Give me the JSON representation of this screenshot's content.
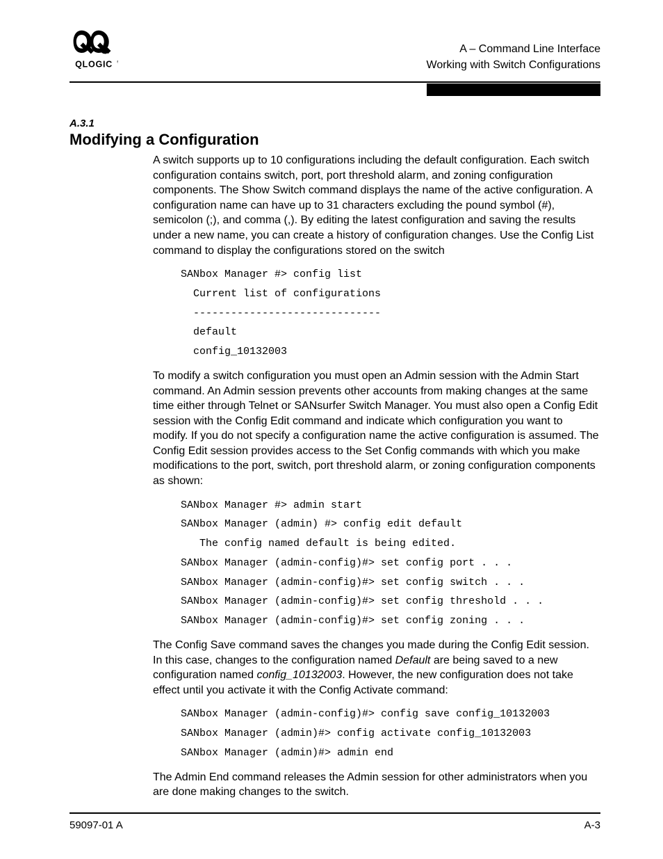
{
  "header": {
    "line1": "A – Command Line Interface",
    "line2": "Working with Switch Configurations"
  },
  "section": {
    "number": "A.3.1",
    "title": "Modifying a Configuration"
  },
  "para1": " A switch supports up to 10 configurations including the default configuration. Each switch configuration contains switch, port, port threshold alarm, and zoning configuration components. The Show Switch command displays the name of the active configuration. A configuration name can have up to 31 characters excluding the pound symbol (#), semicolon (;), and comma (,). By editing the latest configuration and saving the results under a new name, you can create a history of configuration changes. Use the Config List command to display the configurations stored on the switch",
  "code1": "SANbox Manager #> config list\n  Current list of configurations\n  ------------------------------\n  default\n  config_10132003",
  "para2": "To modify a switch configuration you must open an Admin session with the Admin Start command. An Admin session prevents other accounts from making changes at the same time either through Telnet or SANsurfer Switch Manager. You must also open a Config Edit session with the Config Edit command and indicate which configuration you want to modify. If you do not specify a configuration name the active configuration is assumed. The Config Edit session provides access to the Set Config commands with which you make modifications to the port, switch, port threshold alarm, or zoning configuration components as shown:",
  "code2": "SANbox Manager #> admin start\nSANbox Manager (admin) #> config edit default\n   The config named default is being edited.\nSANbox Manager (admin-config)#> set config port . . .\nSANbox Manager (admin-config)#> set config switch . . .\nSANbox Manager (admin-config)#> set config threshold . . .\nSANbox Manager (admin-config)#> set config zoning . . .",
  "para3_pre": "The Config Save command saves the changes you made during the Config Edit session. In this case, changes to the configuration named ",
  "para3_italic1": "Default",
  "para3_mid": " are being saved to a new configuration named ",
  "para3_italic2": "config_10132003",
  "para3_post": ". However, the new configuration does not take effect until you activate it with the Config Activate command:",
  "code3": "SANbox Manager (admin-config)#> config save config_10132003\nSANbox Manager (admin)#> config activate config_10132003\nSANbox Manager (admin)#> admin end",
  "para4": "The Admin End command releases the Admin session for other administrators when you are done making changes to the switch.",
  "footer": {
    "left": "59097-01 A",
    "right": "A-3"
  }
}
